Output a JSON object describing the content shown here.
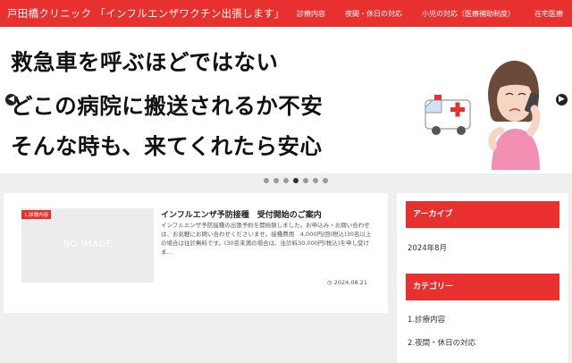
{
  "header": {
    "site_title": "戸田橋クリニック 「インフルエンザワクチン出張します」",
    "nav": [
      "診療内容",
      "夜間・休日の対応",
      "小児の対応（医療補助制度）",
      "在宅医療"
    ]
  },
  "slider": {
    "lines": [
      "救急車を呼ぶほどではない",
      "どこの病院に搬送されるか不安",
      "そんな時も、来てくれたら安心"
    ],
    "prev_icon": "◀",
    "next_icon": "▶",
    "dots_count": 7,
    "active_dot": 3
  },
  "post": {
    "thumb_text": "NO IMAGE",
    "category": "1.診療内容",
    "title": "インフルエンザ予防接種　受付開始のご案内",
    "excerpt": "インフルエンザ予防接種の出張予約を開始致しました。お申込み・お問い合わせは、お気軽にお問い合わせくださいませ。接種費用　4,000円/回(税込)30名以上の場合は往診無料です。(30名未満の場合は、往診料30,000円(税込)を申し受けま…",
    "date": "2024.08.21",
    "date_icon": "◷"
  },
  "sidebar": {
    "archive_title": "アーカイブ",
    "archive_item": "2024年8月",
    "category_title": "カテゴリー",
    "category_items": [
      "1.診療内容",
      "2.夜間・休日の対応"
    ]
  },
  "colors": {
    "brand_red": "#e8302e"
  }
}
